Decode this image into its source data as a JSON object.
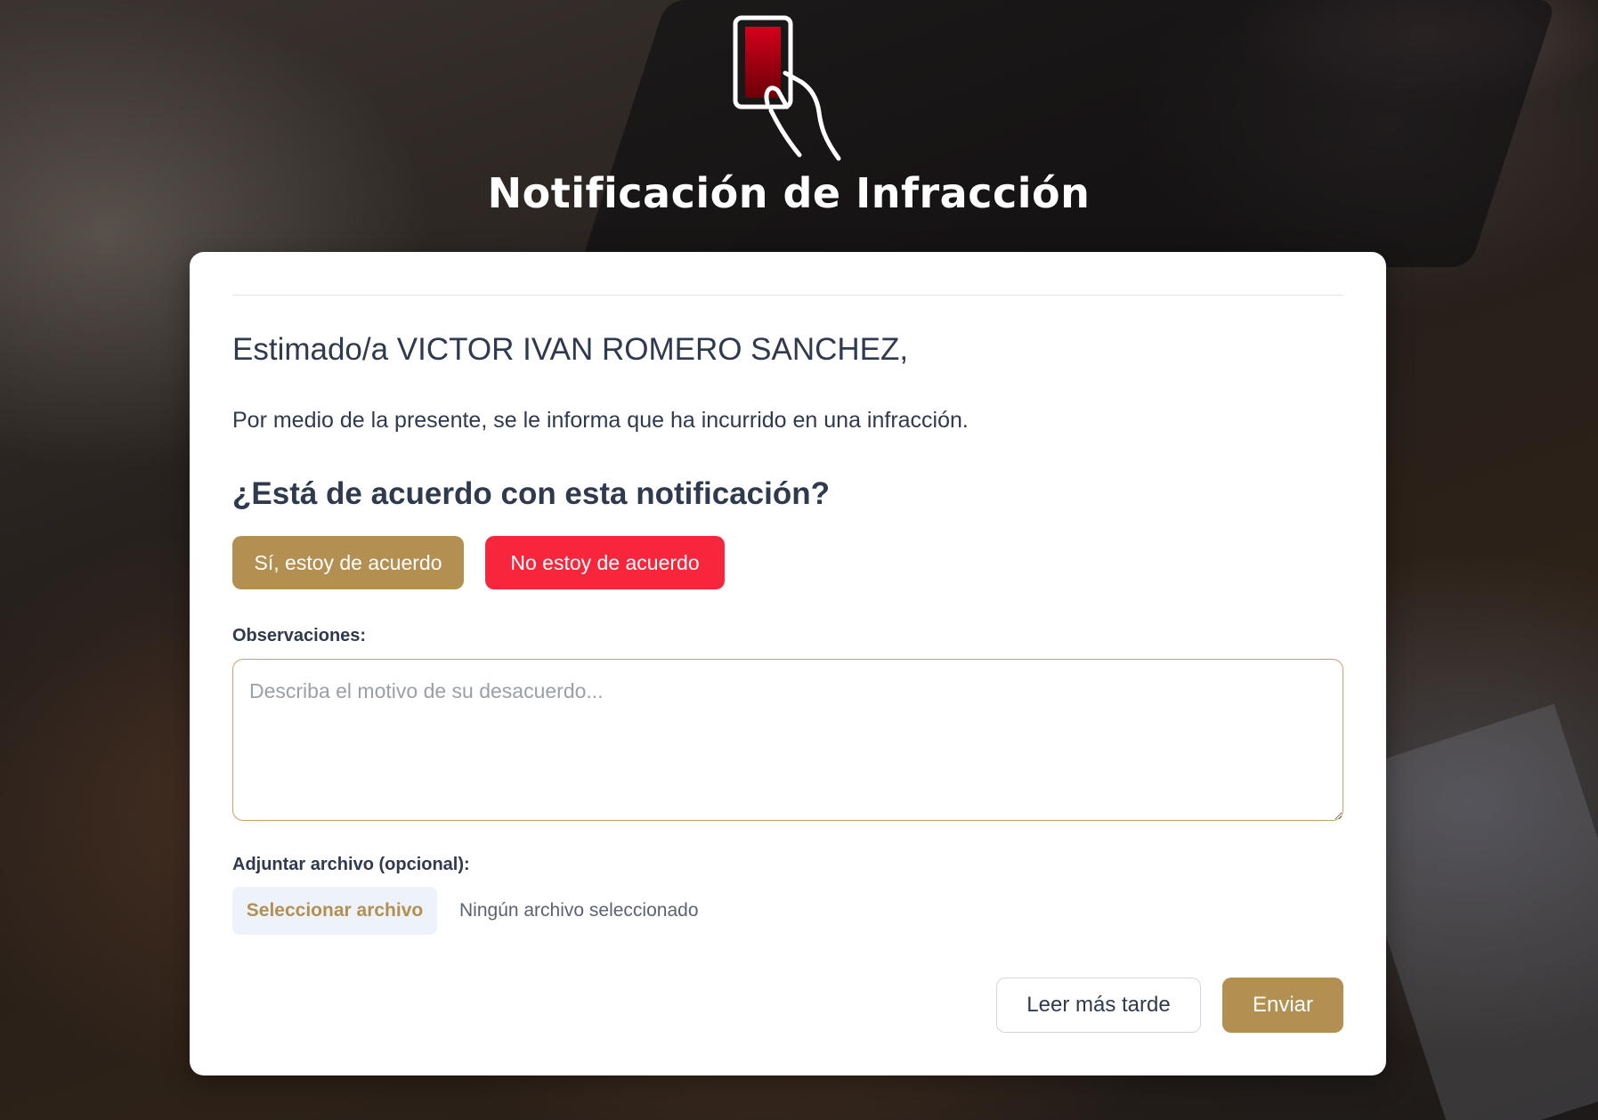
{
  "header": {
    "title": "Notificación de Infracción",
    "logo_icon": "red-card-hand-icon"
  },
  "notice": {
    "greeting": "Estimado/a VICTOR IVAN ROMERO SANCHEZ,",
    "intro": "Por medio de la presente, se le informa que ha incurrido en una infracción.",
    "question": "¿Está de acuerdo con esta notificación?"
  },
  "buttons": {
    "agree": "Sí, estoy de acuerdo",
    "disagree": "No estoy de acuerdo",
    "later": "Leer más tarde",
    "send": "Enviar"
  },
  "observations": {
    "label": "Observaciones:",
    "placeholder": "Describa el motivo de su desacuerdo...",
    "value": ""
  },
  "attachment": {
    "label": "Adjuntar archivo (opcional):",
    "button": "Seleccionar archivo",
    "status": "Ningún archivo seleccionado"
  },
  "colors": {
    "accent": "#b38f52",
    "danger": "#f7263d",
    "text": "#2f3a4e",
    "card_red": "#b3000f"
  }
}
